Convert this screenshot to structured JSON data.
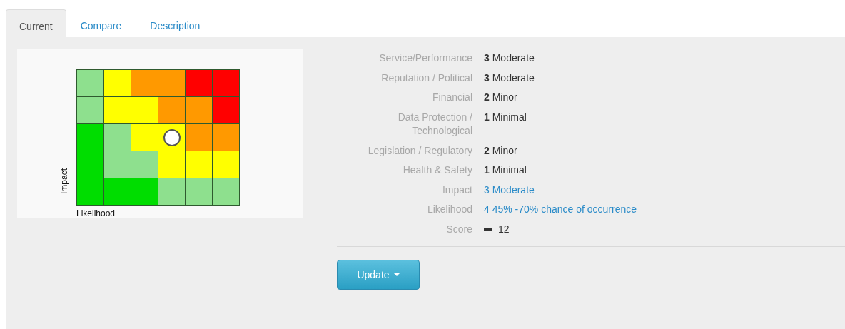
{
  "tabs": [
    {
      "label": "Current",
      "selected": true
    },
    {
      "label": "Compare",
      "selected": false
    },
    {
      "label": "Description",
      "selected": false
    }
  ],
  "matrix": {
    "ylabel": "Impact",
    "xlabel": "Likelihood",
    "rows": [
      {
        "cells": [
          {
            "color": "#8ee08e",
            "selected": false
          },
          {
            "color": "#ffff00",
            "selected": false
          },
          {
            "color": "#ff9900",
            "selected": false
          },
          {
            "color": "#ff9900",
            "selected": false
          },
          {
            "color": "#ff0000",
            "selected": false
          },
          {
            "color": "#ff0000",
            "selected": false
          }
        ]
      },
      {
        "cells": [
          {
            "color": "#8ee08e",
            "selected": false
          },
          {
            "color": "#ffff00",
            "selected": false
          },
          {
            "color": "#ffff00",
            "selected": false
          },
          {
            "color": "#ff9900",
            "selected": false
          },
          {
            "color": "#ff9900",
            "selected": false
          },
          {
            "color": "#ff0000",
            "selected": false
          }
        ]
      },
      {
        "cells": [
          {
            "color": "#00dd00",
            "selected": false
          },
          {
            "color": "#8ee08e",
            "selected": false
          },
          {
            "color": "#ffff00",
            "selected": false
          },
          {
            "color": "#ffff00",
            "selected": true
          },
          {
            "color": "#ff9900",
            "selected": false
          },
          {
            "color": "#ff9900",
            "selected": false
          }
        ]
      },
      {
        "cells": [
          {
            "color": "#00dd00",
            "selected": false
          },
          {
            "color": "#8ee08e",
            "selected": false
          },
          {
            "color": "#8ee08e",
            "selected": false
          },
          {
            "color": "#ffff00",
            "selected": false
          },
          {
            "color": "#ffff00",
            "selected": false
          },
          {
            "color": "#ffff00",
            "selected": false
          }
        ]
      },
      {
        "cells": [
          {
            "color": "#00dd00",
            "selected": false
          },
          {
            "color": "#00dd00",
            "selected": false
          },
          {
            "color": "#00dd00",
            "selected": false
          },
          {
            "color": "#8ee08e",
            "selected": false
          },
          {
            "color": "#8ee08e",
            "selected": false
          },
          {
            "color": "#8ee08e",
            "selected": false
          }
        ]
      }
    ]
  },
  "details": [
    {
      "label": "Service/Performance",
      "kind": "plain",
      "number": "3",
      "value": "Moderate"
    },
    {
      "label": "Reputation / Political",
      "kind": "plain",
      "number": "3",
      "value": "Moderate"
    },
    {
      "label": "Financial",
      "kind": "plain",
      "number": "2",
      "value": "Minor"
    },
    {
      "label": "Data Protection / Technological",
      "kind": "plain",
      "number": "1",
      "value": "Minimal"
    },
    {
      "label": "Legislation / Regulatory",
      "kind": "plain",
      "number": "2",
      "value": "Minor"
    },
    {
      "label": "Health & Safety",
      "kind": "plain",
      "number": "1",
      "value": "Minimal"
    },
    {
      "label": "Impact",
      "kind": "link",
      "number": "3",
      "value": "Moderate"
    },
    {
      "label": "Likelihood",
      "kind": "link",
      "number": "4",
      "value": "45% -70% chance of occurrence"
    },
    {
      "label": "Score",
      "kind": "score",
      "number": "12"
    }
  ],
  "update_button": {
    "label": "Update"
  }
}
